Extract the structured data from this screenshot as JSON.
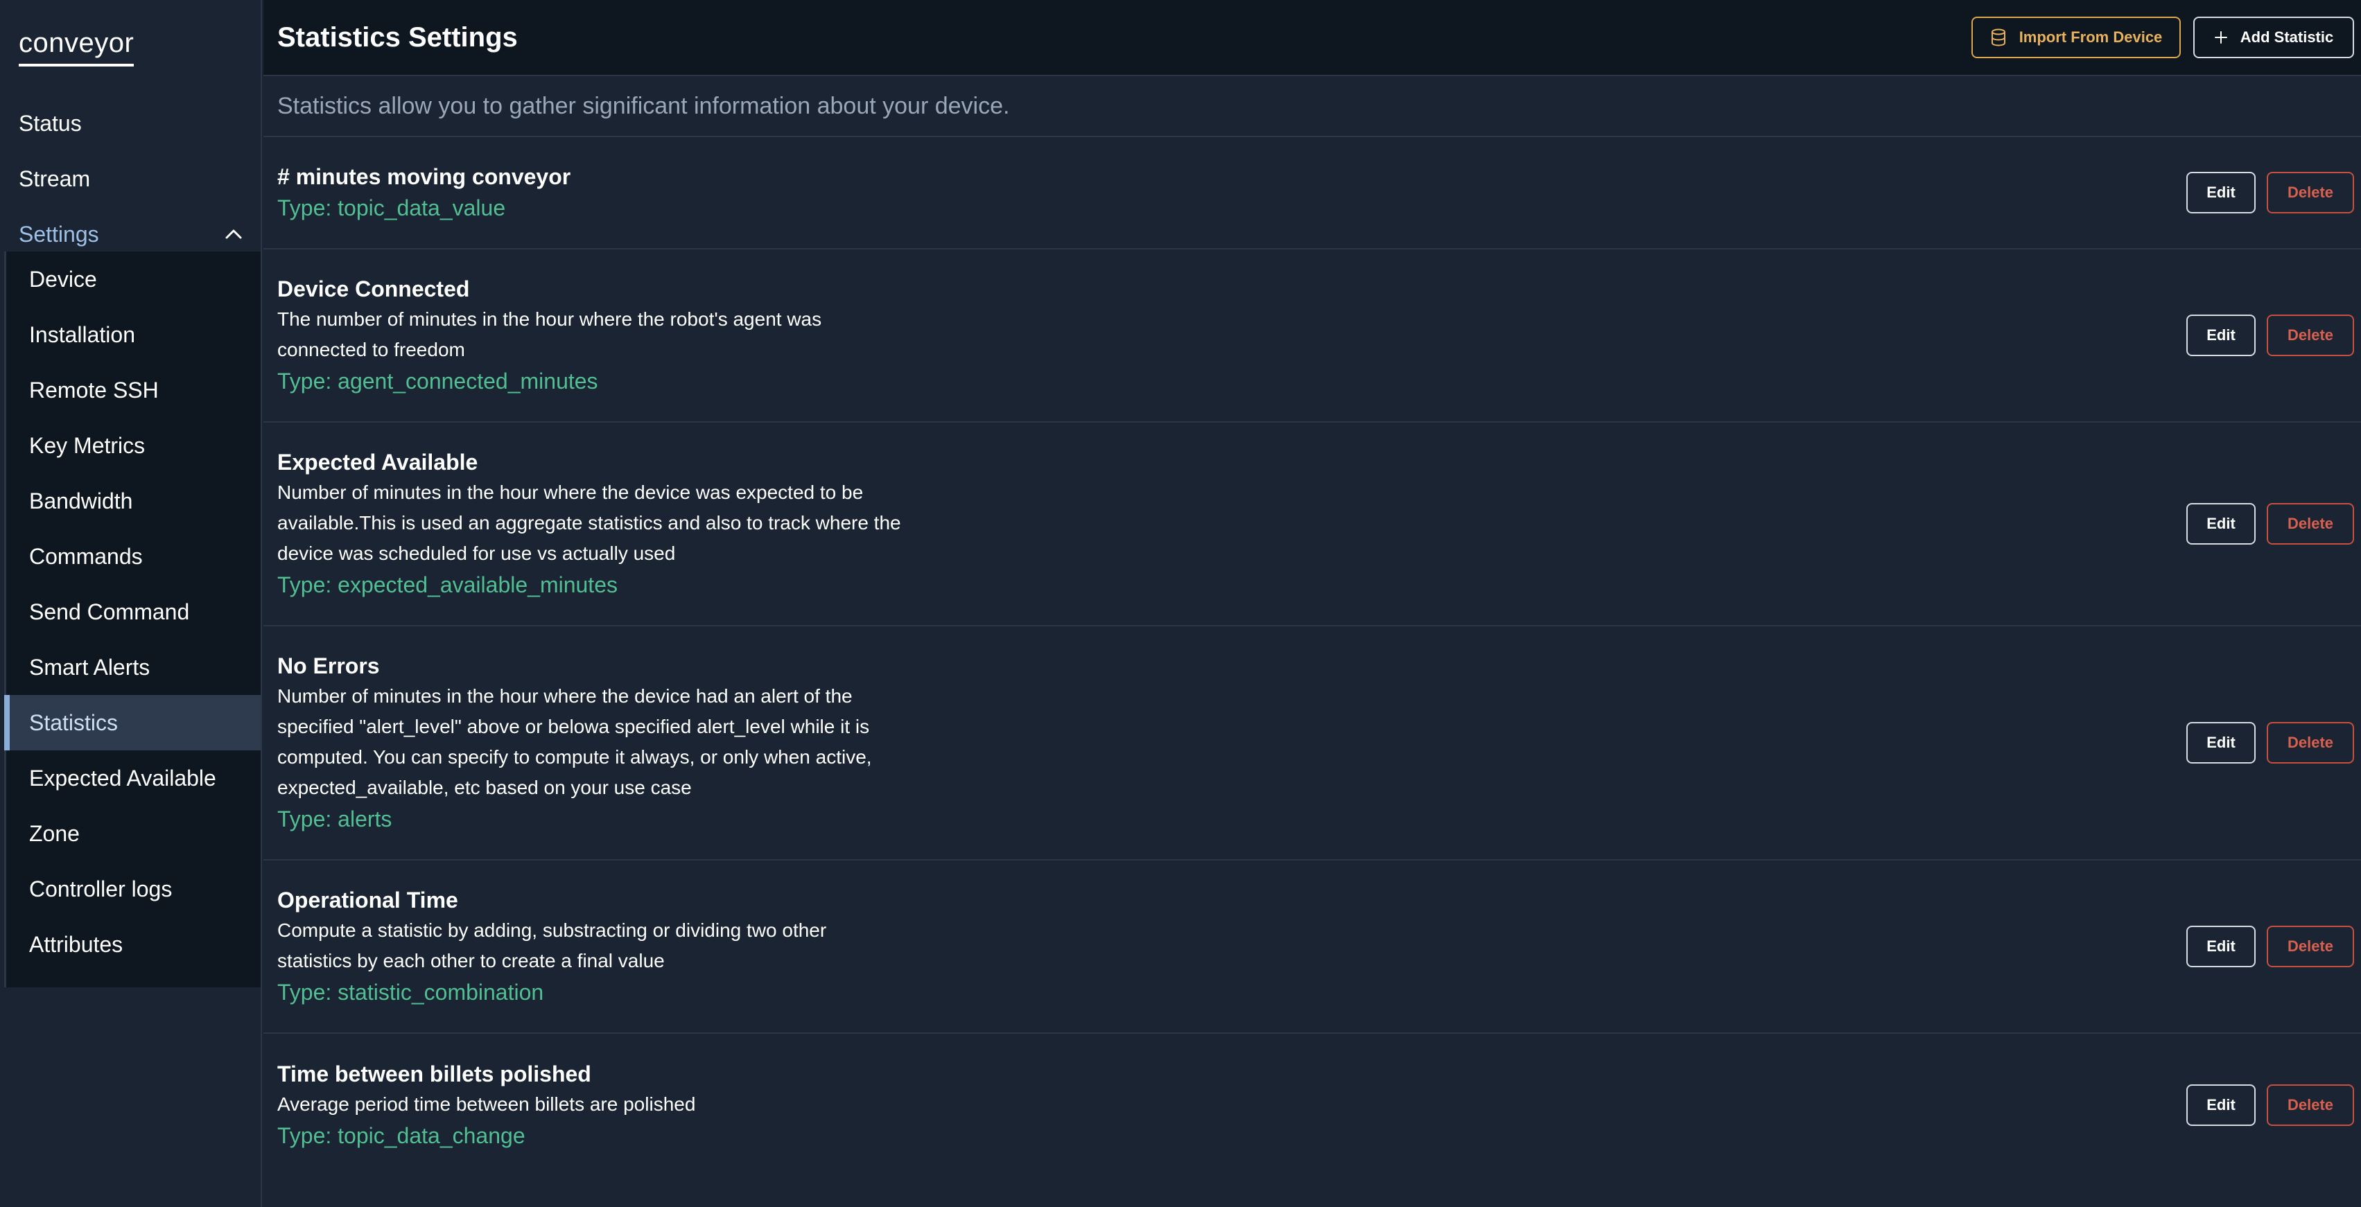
{
  "app": {
    "logo": "conveyor"
  },
  "sidebar": {
    "top_items": [
      {
        "label": "Status"
      },
      {
        "label": "Stream"
      }
    ],
    "settings": {
      "label": "Settings",
      "icon": "chevron-up-icon"
    },
    "sub_items": [
      {
        "label": "Device"
      },
      {
        "label": "Installation"
      },
      {
        "label": "Remote SSH"
      },
      {
        "label": "Key Metrics"
      },
      {
        "label": "Bandwidth"
      },
      {
        "label": "Commands"
      },
      {
        "label": "Send Command"
      },
      {
        "label": "Smart Alerts"
      },
      {
        "label": "Statistics",
        "active": true
      },
      {
        "label": "Expected Available"
      },
      {
        "label": "Zone"
      },
      {
        "label": "Controller logs"
      },
      {
        "label": "Attributes"
      }
    ]
  },
  "header": {
    "title": "Statistics Settings",
    "import_label": "Import From Device",
    "import_icon": "database-icon",
    "add_label": "Add Statistic",
    "add_icon": "plus-icon"
  },
  "subtitle": "Statistics allow you to gather significant information about your device.",
  "row_actions": {
    "edit_label": "Edit",
    "delete_label": "Delete"
  },
  "statistics": [
    {
      "name": "# minutes moving conveyor",
      "description": [],
      "type": "Type: topic_data_value"
    },
    {
      "name": "Device Connected",
      "description": [
        "The number of minutes in the hour where the robot's agent was",
        "connected to freedom"
      ],
      "type": "Type: agent_connected_minutes"
    },
    {
      "name": "Expected Available",
      "description": [
        "Number of minutes in the hour where the device was expected to be",
        "available.This is used an aggregate statistics and also to track where the",
        "device was scheduled for use vs actually used"
      ],
      "type": "Type: expected_available_minutes"
    },
    {
      "name": "No Errors",
      "description": [
        "Number of minutes in the hour where the device had an alert of the",
        "specified \"alert_level\" above or belowa specified alert_level while it is",
        "computed. You can specify to compute it always, or only when active,",
        "expected_available, etc based on your use case"
      ],
      "type": "Type: alerts"
    },
    {
      "name": "Operational Time",
      "description": [
        "Compute a statistic by adding, substracting or dividing two other",
        "statistics by each other to create a final value"
      ],
      "type": "Type: statistic_combination"
    },
    {
      "name": "Time between billets polished",
      "description": [
        "Average period time between billets are polished"
      ],
      "type": "Type: topic_data_change"
    }
  ],
  "colors": {
    "background": "#1a2433",
    "header_bg": "#0e161f",
    "accent_import": "#e0a64a",
    "type_green": "#52bf93",
    "delete_red": "#d9604e",
    "settings_blue": "#9fc0e6"
  }
}
